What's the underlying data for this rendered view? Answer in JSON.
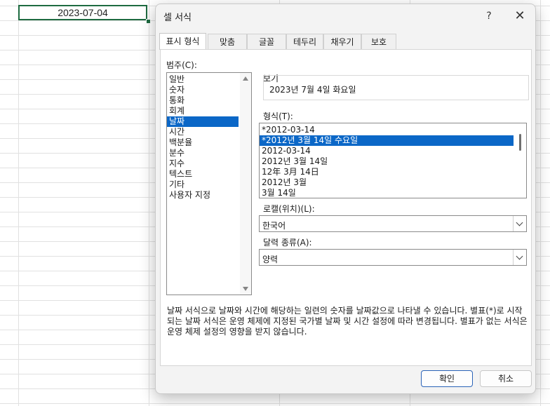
{
  "sheet": {
    "active_cell_value": "2023-07-04"
  },
  "dialog": {
    "title": "셀 서식",
    "help_glyph": "?",
    "close_glyph": "✕",
    "tabs": [
      {
        "label": "표시 형식",
        "active": true
      },
      {
        "label": "맞춤",
        "active": false
      },
      {
        "label": "글꼴",
        "active": false
      },
      {
        "label": "테두리",
        "active": false
      },
      {
        "label": "채우기",
        "active": false
      },
      {
        "label": "보호",
        "active": false
      }
    ],
    "category_label": "범주(C):",
    "categories": [
      "일반",
      "숫자",
      "통화",
      "회계",
      "날짜",
      "시간",
      "백분율",
      "분수",
      "지수",
      "텍스트",
      "기타",
      "사용자 지정"
    ],
    "selected_category": "날짜",
    "sample_label": "보기",
    "sample_value": "2023년 7월 4일 화요일",
    "type_label": "형식(T):",
    "types": [
      "*2012-03-14",
      "*2012년 3월 14일 수요일",
      "2012-03-14",
      "2012년 3월 14일",
      "12年 3月 14日",
      "2012년 3월",
      "3월 14일"
    ],
    "selected_type": "*2012년 3월 14일 수요일",
    "locale_label": "로캘(위치)(L):",
    "locale_value": "한국어",
    "calendar_label": "달력 종류(A):",
    "calendar_value": "양력",
    "description": "날짜 서식으로 날짜와 시간에 해당하는 일련의 숫자를 날짜값으로 나타낼 수 있습니다. 별표(*)로 시작되는 날짜 서식은 운영 체제에 지정된 국가별 날짜 및 시간 설정에 따라 변경됩니다. 별표가 없는 서식은 운영 체제 설정의 영향을 받지 않습니다.",
    "ok_label": "확인",
    "cancel_label": "취소"
  },
  "colors": {
    "selection": "#0b67c7",
    "cell_border": "#1e6b41",
    "primary_border": "#2a63b8"
  }
}
